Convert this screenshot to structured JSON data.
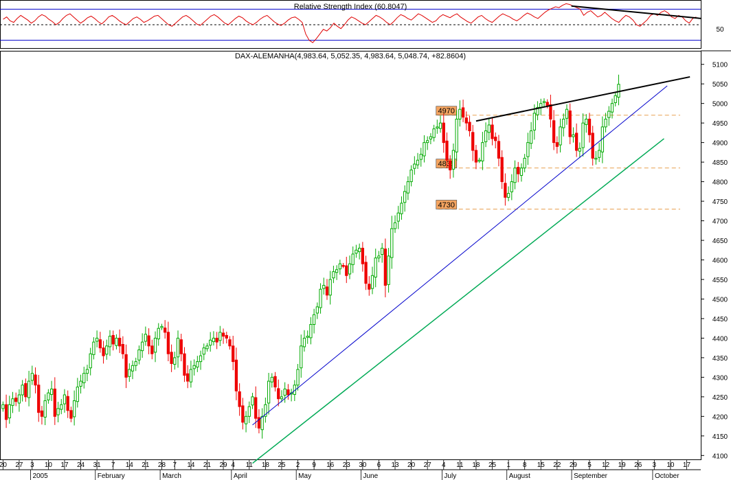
{
  "chart_data": [
    {
      "type": "line",
      "title": "Relative Strength Index (60.8047)",
      "ytick_labels": [
        "50"
      ],
      "ylim": [
        20,
        80
      ],
      "midline": 50,
      "bounds": [
        70,
        30
      ],
      "colors": {
        "line": "#e00000",
        "bounds": "#0000cc",
        "trend": "#000000"
      },
      "series": [
        {
          "values": [
            57,
            60,
            55,
            53,
            58,
            62,
            59,
            56,
            52,
            55,
            60,
            63,
            61,
            57,
            54,
            50,
            53,
            58,
            62,
            64,
            60,
            56,
            52,
            55,
            59,
            61,
            58,
            54,
            51,
            55,
            60,
            62,
            59,
            55,
            52,
            50,
            54,
            58,
            60,
            57,
            53,
            55,
            58,
            61,
            62,
            58,
            54,
            50,
            48,
            52,
            56,
            60,
            62,
            59,
            55,
            51,
            49,
            53,
            57,
            61,
            63,
            60,
            56,
            52,
            50,
            54,
            58,
            61,
            59,
            55,
            52,
            50,
            53,
            57,
            60,
            62,
            58,
            54,
            51,
            49,
            52,
            56,
            59,
            60,
            57,
            53,
            38,
            30,
            27,
            32,
            38,
            44,
            42,
            46,
            52,
            48,
            45,
            50,
            56,
            60,
            58,
            55,
            52,
            50,
            54,
            58,
            62,
            60,
            57,
            53,
            50,
            54,
            59,
            63,
            61,
            58,
            56,
            60,
            64,
            62,
            59,
            56,
            53,
            55,
            60,
            63,
            61,
            59,
            62,
            64,
            60,
            57,
            54,
            52,
            56,
            60,
            62,
            58,
            55,
            53,
            57,
            61,
            64,
            62,
            60,
            57,
            55,
            58,
            62,
            65,
            63,
            60,
            58,
            62,
            66,
            69,
            71,
            73,
            72,
            75,
            77,
            76,
            74,
            72,
            70,
            62,
            66,
            68,
            64,
            60,
            62,
            66,
            62,
            58,
            55,
            53,
            58,
            62,
            60,
            56,
            50,
            48,
            52,
            56,
            62,
            64,
            62,
            66,
            68,
            65,
            60,
            58,
            62,
            60,
            55,
            52,
            58,
            60
          ]
        }
      ],
      "trendline": {
        "from": [
          162,
          74
        ],
        "to": [
          199,
          58
        ]
      }
    },
    {
      "type": "candlestick",
      "title": "DAX-ALEMANHA(4,983.64, 5,052.35, 4,983.64, 5,048.74, +82.8604)",
      "x_tick_labels": [
        "20",
        "27",
        "3",
        "10",
        "17",
        "24",
        "31",
        "7",
        "14",
        "21",
        "28",
        "7",
        "14",
        "21",
        "29",
        "4",
        "11",
        "18",
        "25",
        "2",
        "9",
        "16",
        "23",
        "30",
        "6",
        "13",
        "20",
        "27",
        "4",
        "11",
        "18",
        "25",
        "1",
        "8",
        "15",
        "22",
        "29",
        "5",
        "12",
        "19",
        "26",
        "3",
        "10",
        "17"
      ],
      "x_tick_index": [
        0,
        5,
        9,
        14,
        19,
        24,
        29,
        34,
        39,
        44,
        49,
        53,
        58,
        63,
        68,
        71,
        76,
        81,
        86,
        91,
        96,
        101,
        106,
        111,
        116,
        121,
        126,
        131,
        136,
        141,
        146,
        151,
        156,
        161,
        166,
        171,
        176,
        181,
        186,
        191,
        196,
        201,
        206,
        211
      ],
      "month_labels": [
        "2005",
        "February",
        "March",
        "April",
        "May",
        "June",
        "July",
        "August",
        "September",
        "October"
      ],
      "month_index": [
        9,
        29,
        49,
        71,
        91,
        111,
        136,
        156,
        176,
        201
      ],
      "ytick_labels": [
        "4100",
        "4150",
        "4200",
        "4250",
        "4300",
        "4350",
        "4400",
        "4450",
        "4500",
        "4550",
        "4600",
        "4650",
        "4700",
        "4750",
        "4800",
        "4850",
        "4900",
        "4950",
        "5000",
        "5050",
        "5100"
      ],
      "ylim": [
        4090,
        5110
      ],
      "colors": {
        "up": "#00aa00",
        "down": "#ee0000",
        "channel_upper": "#0000cc",
        "channel_lower": "#00aa55",
        "resistance": "#000000",
        "level_line": "#e8a050",
        "level_box": "#f4a460"
      },
      "levels": [
        {
          "label": "4970",
          "value": 4970
        },
        {
          "label": "4835",
          "value": 4835
        },
        {
          "label": "4730",
          "value": 4730
        }
      ],
      "trendlines": [
        {
          "name": "blue-channel",
          "from": [
            77,
            4178
          ],
          "to": [
            205,
            5045
          ]
        },
        {
          "name": "green-channel",
          "from": [
            77,
            4080
          ],
          "to": [
            204,
            4910
          ]
        },
        {
          "name": "resistance",
          "from": [
            146,
            4955
          ],
          "to": [
            212,
            5068
          ]
        }
      ],
      "closes": [
        4230,
        4192,
        4230,
        4245,
        4238,
        4255,
        4280,
        4250,
        4290,
        4310,
        4280,
        4210,
        4200,
        4240,
        4260,
        4270,
        4200,
        4220,
        4230,
        4255,
        4215,
        4195,
        4240,
        4275,
        4290,
        4310,
        4320,
        4360,
        4390,
        4400,
        4375,
        4355,
        4380,
        4405,
        4385,
        4400,
        4380,
        4360,
        4300,
        4320,
        4330,
        4340,
        4370,
        4390,
        4410,
        4380,
        4360,
        4400,
        4425,
        4430,
        4415,
        4360,
        4335,
        4350,
        4400,
        4360,
        4305,
        4290,
        4320,
        4330,
        4340,
        4355,
        4375,
        4380,
        4395,
        4400,
        4390,
        4415,
        4405,
        4400,
        4380,
        4340,
        4265,
        4225,
        4185,
        4200,
        4225,
        4250,
        4195,
        4170,
        4200,
        4230,
        4290,
        4300,
        4275,
        4245,
        4250,
        4270,
        4255,
        4260,
        4280,
        4320,
        4380,
        4400,
        4405,
        4435,
        4460,
        4480,
        4525,
        4535,
        4510,
        4550,
        4570,
        4575,
        4590,
        4585,
        4560,
        4590,
        4615,
        4625,
        4630,
        4590,
        4540,
        4525,
        4560,
        4605,
        4610,
        4630,
        4535,
        4610,
        4680,
        4695,
        4720,
        4745,
        4775,
        4800,
        4830,
        4845,
        4855,
        4870,
        4900,
        4905,
        4915,
        4935,
        4940,
        4950,
        4900,
        4855,
        4830,
        4880,
        4960,
        4985,
        4965,
        4950,
        4930,
        4880,
        4850,
        4855,
        4900,
        4930,
        4945,
        4910,
        4905,
        4860,
        4800,
        4760,
        4770,
        4800,
        4835,
        4820,
        4835,
        4860,
        4900,
        4930,
        4975,
        4990,
        5000,
        5005,
        4995,
        4960,
        4900,
        4890,
        4940,
        4960,
        4985,
        4915,
        4920,
        4880,
        4885,
        4950,
        4960,
        4920,
        4860,
        4860,
        4880,
        4940,
        4960,
        4980,
        5000,
        5020,
        5049
      ],
      "n_days": 215
    }
  ]
}
